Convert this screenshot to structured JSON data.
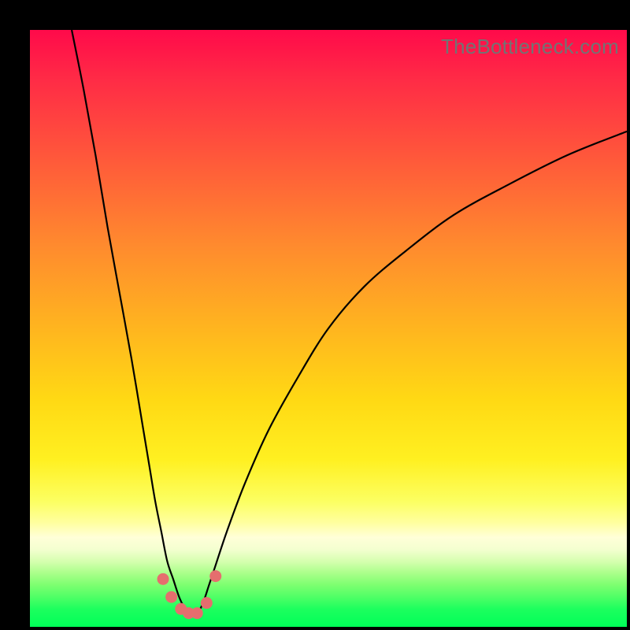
{
  "watermark": "TheBottleneck.com",
  "colors": {
    "background": "#000000",
    "gradient_top": "#ff0a4a",
    "gradient_mid": "#ffd914",
    "gradient_bottom": "#00ff58",
    "curve": "#000000",
    "marker": "#e56e6e",
    "watermark_text": "#737373"
  },
  "chart_data": {
    "type": "line",
    "title": "",
    "xlabel": "",
    "ylabel": "",
    "xlim": [
      0,
      100
    ],
    "ylim": [
      0,
      100
    ],
    "grid": false,
    "legend": false,
    "series": [
      {
        "name": "left-curve",
        "x": [
          7,
          9,
          11,
          13,
          15,
          17,
          19,
          20,
          21,
          22,
          23,
          24,
          25,
          26,
          27
        ],
        "y": [
          100,
          90,
          79,
          67,
          56,
          45,
          33,
          27,
          21,
          16,
          11,
          8,
          5,
          3,
          2
        ]
      },
      {
        "name": "right-curve",
        "x": [
          28,
          29,
          30,
          31,
          33,
          36,
          40,
          45,
          50,
          56,
          63,
          71,
          80,
          90,
          100
        ],
        "y": [
          2,
          4,
          7,
          10,
          16,
          24,
          33,
          42,
          50,
          57,
          63,
          69,
          74,
          79,
          83
        ]
      }
    ],
    "markers": {
      "name": "bottom-cluster",
      "x": [
        22.3,
        23.7,
        25.3,
        26.6,
        28.0,
        29.6,
        31.1
      ],
      "y": [
        8.0,
        5.0,
        3.0,
        2.3,
        2.3,
        4.0,
        8.5
      ]
    }
  }
}
